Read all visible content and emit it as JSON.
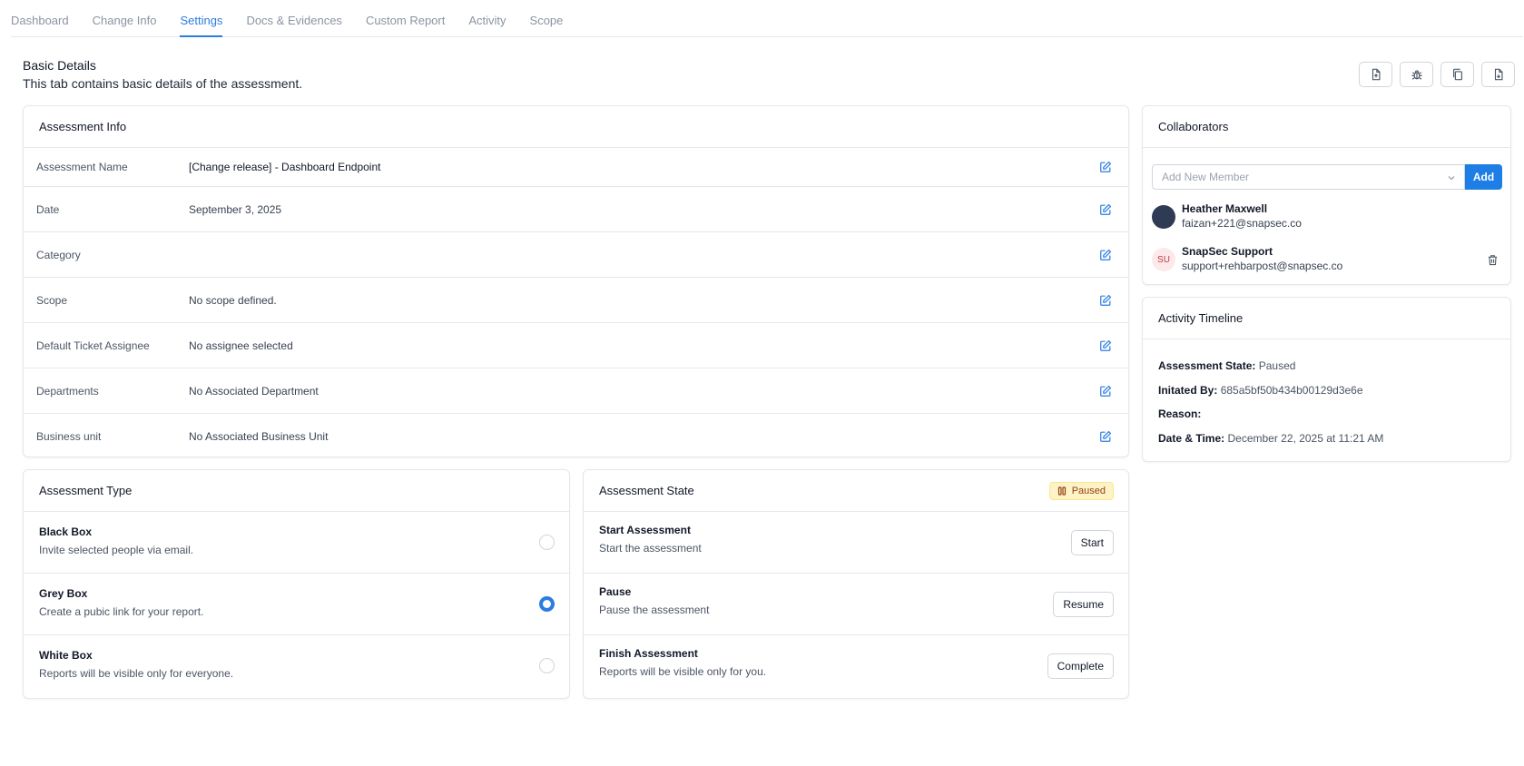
{
  "tabs": [
    {
      "label": "Dashboard"
    },
    {
      "label": "Change Info"
    },
    {
      "label": "Settings",
      "active": true
    },
    {
      "label": "Docs & Evidences"
    },
    {
      "label": "Custom Report"
    },
    {
      "label": "Activity"
    },
    {
      "label": "Scope"
    }
  ],
  "header": {
    "title": "Basic Details",
    "description": "This tab contains basic details of the assessment.",
    "actions": [
      "export-file-icon",
      "bug-icon",
      "copy-icon",
      "download-file-icon"
    ]
  },
  "assessment_info": {
    "title": "Assessment Info",
    "rows": [
      {
        "label": "Assessment Name",
        "value": "[Change release] - Dashboard Endpoint"
      },
      {
        "label": "Date",
        "value": "September 3, 2025"
      },
      {
        "label": "Category",
        "value": ""
      },
      {
        "label": "Scope",
        "value": "No scope defined."
      },
      {
        "label": "Default Ticket Assignee",
        "value": "No assignee selected"
      },
      {
        "label": "Departments",
        "value": "No Associated Department"
      },
      {
        "label": "Business unit",
        "value": "No Associated Business Unit"
      }
    ]
  },
  "assessment_type": {
    "title": "Assessment Type",
    "options": [
      {
        "title": "Black Box",
        "desc": "Invite selected people via email.",
        "selected": false
      },
      {
        "title": "Grey Box",
        "desc": "Create a pubic link for your report.",
        "selected": true
      },
      {
        "title": "White Box",
        "desc": "Reports will be visible only for everyone.",
        "selected": false
      }
    ]
  },
  "assessment_state": {
    "title": "Assessment State",
    "badge": "Paused",
    "colors": {
      "badge_bg": "#fef3c7",
      "badge_text": "#92400e"
    },
    "rows": [
      {
        "title": "Start Assessment",
        "desc": "Start the assessment",
        "button": "Start"
      },
      {
        "title": "Pause",
        "desc": "Pause the assessment",
        "button": "Resume"
      },
      {
        "title": "Finish Assessment",
        "desc": "Reports will be visible only for you.",
        "button": "Complete"
      }
    ]
  },
  "collaborators": {
    "title": "Collaborators",
    "placeholder": "Add New Member",
    "add_label": "Add",
    "members": [
      {
        "name": "Heather Maxwell",
        "email": "faizan+221@snapsec.co",
        "initials": ""
      },
      {
        "name": "SnapSec Support",
        "email": "support+rehbarpost@snapsec.co",
        "initials": "SU"
      }
    ]
  },
  "activity_timeline": {
    "title": "Activity Timeline",
    "rows": [
      {
        "label": "Assessment State:",
        "value": "Paused"
      },
      {
        "label": "Initated By:",
        "value": "685a5bf50b434b00129d3e6e"
      },
      {
        "label": "Reason:",
        "value": ""
      },
      {
        "label": "Date & Time:",
        "value": "December 22, 2025 at 11:21 AM"
      }
    ]
  },
  "colors": {
    "accent": "#2a7de1",
    "primary_button": "#1d7ee6"
  }
}
